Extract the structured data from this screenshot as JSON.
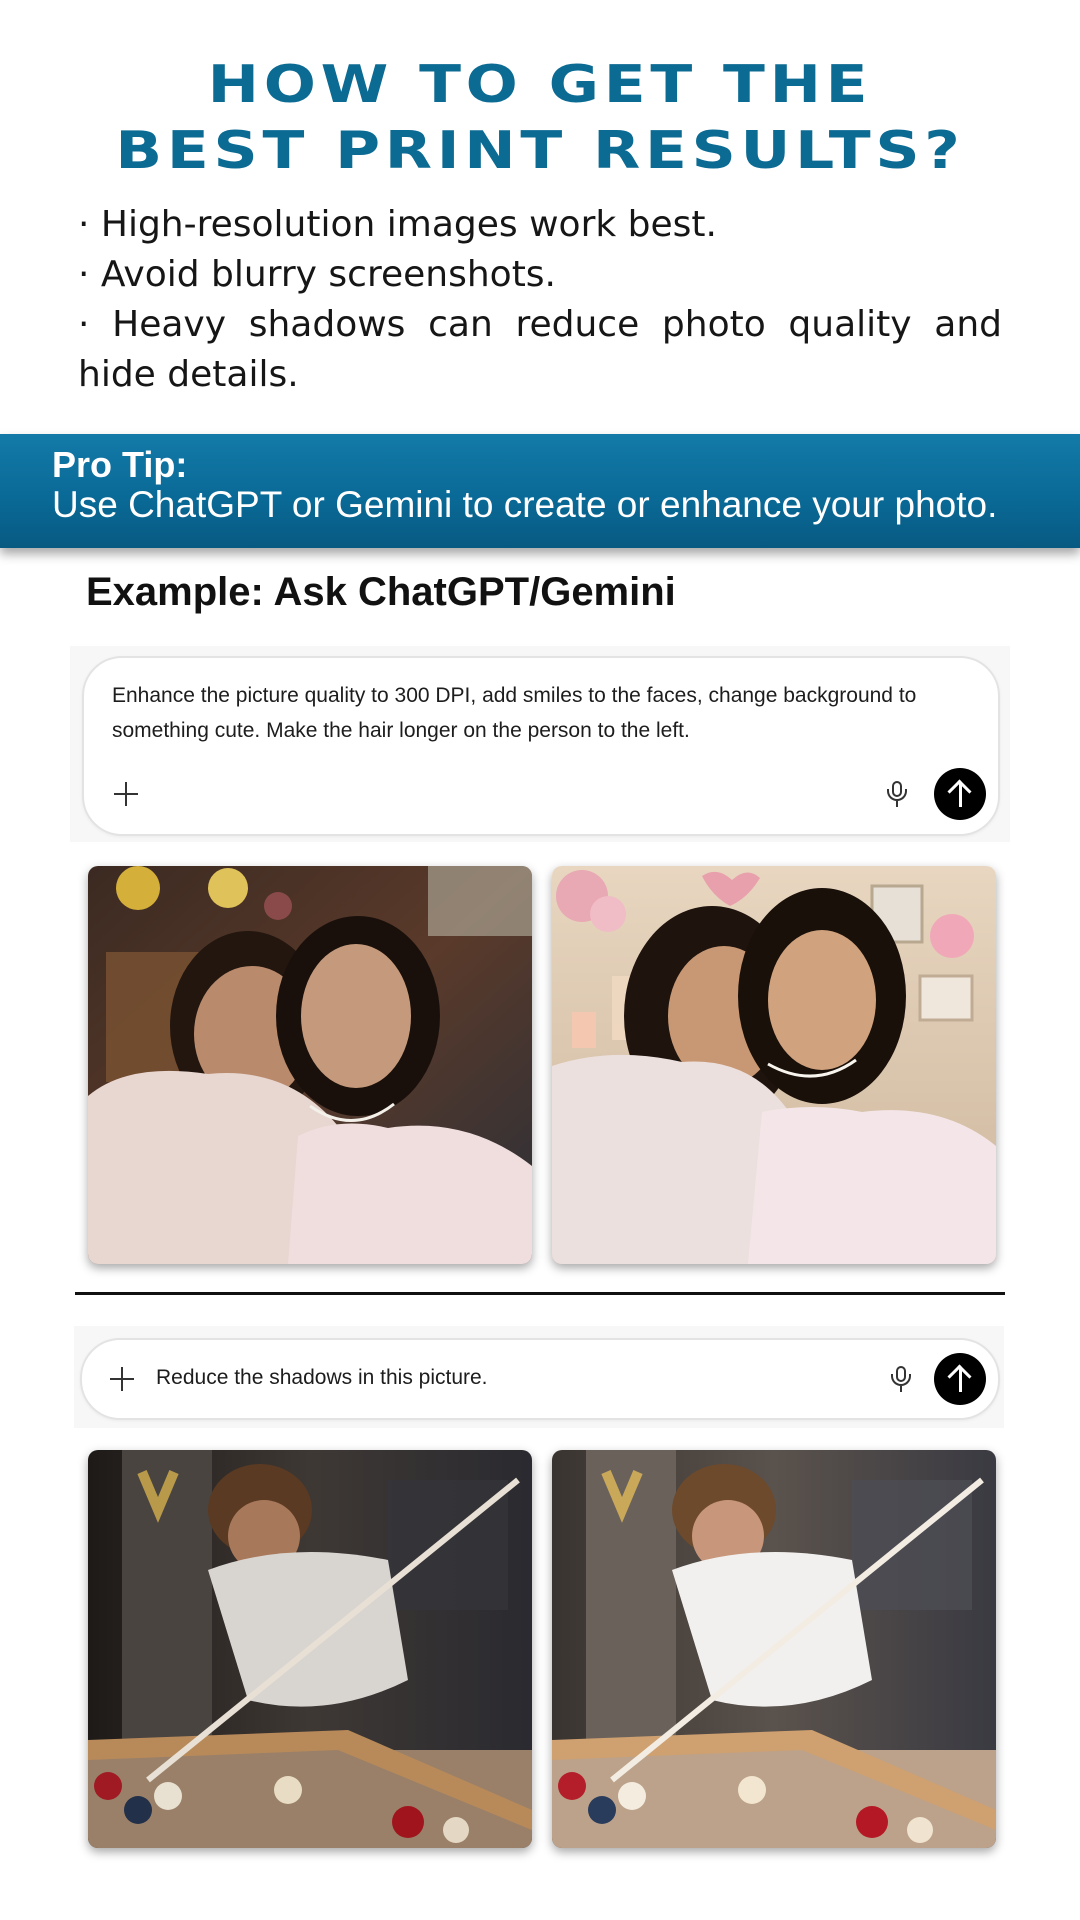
{
  "title": {
    "line1": "HOW TO GET THE",
    "line2": "BEST PRINT RESULTS?"
  },
  "bullets": [
    "· High-resolution images work best.",
    "· Avoid blurry screenshots.",
    "· Heavy shadows can reduce photo quality and hide details."
  ],
  "pro_tip": {
    "heading": "Pro Tip:",
    "text": "Use ChatGPT or Gemini to create or enhance your photo."
  },
  "example_heading": "Example: Ask ChatGPT/Gemini",
  "prompt1": {
    "text": "Enhance the picture quality to 300 DPI, add smiles to the faces, change background to something cute. Make the hair longer on the person to the left.",
    "icons": [
      "plus-icon",
      "mic-icon",
      "send-arrow-icon"
    ]
  },
  "prompt2": {
    "text": "Reduce the shadows in this picture.",
    "icons": [
      "plus-icon",
      "mic-icon",
      "send-arrow-icon"
    ]
  },
  "colors": {
    "title": "#0c6b93",
    "tip_band": "#0a6a97",
    "send_button": "#000000"
  }
}
